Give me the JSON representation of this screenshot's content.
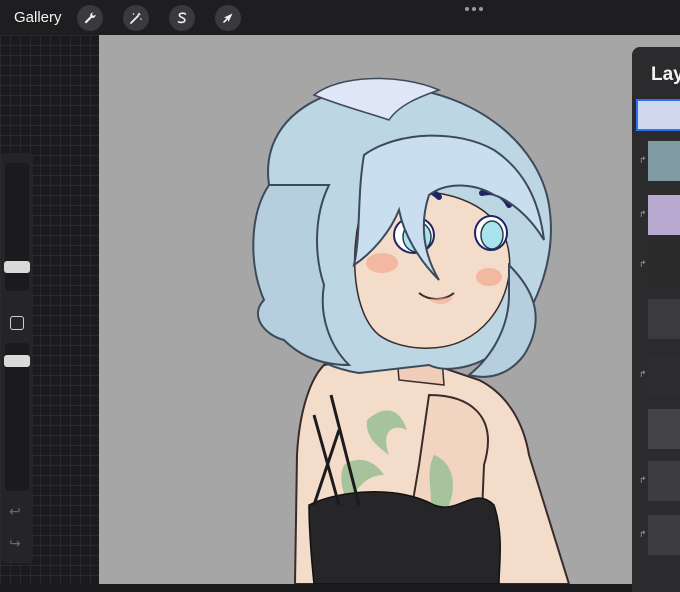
{
  "topbar": {
    "gallery_label": "Gallery",
    "tools": [
      {
        "name": "actions",
        "icon": "wrench-icon"
      },
      {
        "name": "adjustments",
        "icon": "magic-wand-icon"
      },
      {
        "name": "selection",
        "icon": "selection-s-icon"
      },
      {
        "name": "transform",
        "icon": "arrow-cursor-icon"
      }
    ]
  },
  "layers": {
    "title": "Lay",
    "rows": [
      {
        "clipped": false,
        "active": true,
        "thumb_color": "#cfd8ef"
      },
      {
        "clipped": true,
        "active": false,
        "thumb_color": "#7f9aa1"
      },
      {
        "clipped": true,
        "active": false,
        "thumb_color": "#b7a9cf"
      },
      {
        "clipped": true,
        "active": false,
        "thumb_color": "#2a2a2a"
      },
      {
        "clipped": false,
        "active": false,
        "thumb_color": "#3b3b3e"
      },
      {
        "clipped": true,
        "active": false,
        "thumb_color": "#2d2d2f"
      },
      {
        "clipped": false,
        "active": false,
        "thumb_color": "#444448"
      },
      {
        "clipped": true,
        "active": false,
        "thumb_color": "#3e3e42"
      },
      {
        "clipped": true,
        "active": false,
        "thumb_color": "#3e3e42"
      }
    ]
  },
  "colors": {
    "canvas_bg": "#a6a6a6",
    "hair": "#bcd6e4",
    "skin": "#f4dcca",
    "tattoo": "#a7c39d",
    "top": "#262628",
    "eye": "#a9e3ee",
    "brow": "#1e2466"
  }
}
